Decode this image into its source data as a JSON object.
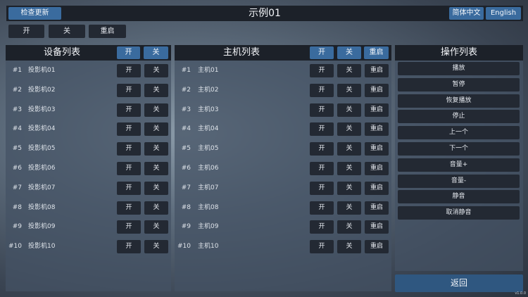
{
  "header": {
    "title": "示例01",
    "check_update_label": "检查更新",
    "lang_zh_label": "简体中文",
    "lang_en_label": "English"
  },
  "quick_actions": {
    "on_label": "开",
    "off_label": "关",
    "restart_label": "重启"
  },
  "device_panel": {
    "title": "设备列表",
    "on_label": "开",
    "off_label": "关",
    "items": [
      {
        "num": "#1",
        "name": "投影机01",
        "on": "开",
        "off": "关"
      },
      {
        "num": "#2",
        "name": "投影机02",
        "on": "开",
        "off": "关"
      },
      {
        "num": "#3",
        "name": "投影机03",
        "on": "开",
        "off": "关"
      },
      {
        "num": "#4",
        "name": "投影机04",
        "on": "开",
        "off": "关"
      },
      {
        "num": "#5",
        "name": "投影机05",
        "on": "开",
        "off": "关"
      },
      {
        "num": "#6",
        "name": "投影机06",
        "on": "开",
        "off": "关"
      },
      {
        "num": "#7",
        "name": "投影机07",
        "on": "开",
        "off": "关"
      },
      {
        "num": "#8",
        "name": "投影机08",
        "on": "开",
        "off": "关"
      },
      {
        "num": "#9",
        "name": "投影机09",
        "on": "开",
        "off": "关"
      },
      {
        "num": "#10",
        "name": "投影机10",
        "on": "开",
        "off": "关"
      }
    ]
  },
  "host_panel": {
    "title": "主机列表",
    "on_label": "开",
    "off_label": "关",
    "restart_label": "重启",
    "items": [
      {
        "num": "#1",
        "name": "主机01",
        "on": "开",
        "off": "关",
        "restart": "重启"
      },
      {
        "num": "#2",
        "name": "主机02",
        "on": "开",
        "off": "关",
        "restart": "重启"
      },
      {
        "num": "#3",
        "name": "主机03",
        "on": "开",
        "off": "关",
        "restart": "重启"
      },
      {
        "num": "#4",
        "name": "主机04",
        "on": "开",
        "off": "关",
        "restart": "重启"
      },
      {
        "num": "#5",
        "name": "主机05",
        "on": "开",
        "off": "关",
        "restart": "重启"
      },
      {
        "num": "#6",
        "name": "主机06",
        "on": "开",
        "off": "关",
        "restart": "重启"
      },
      {
        "num": "#7",
        "name": "主机07",
        "on": "开",
        "off": "关",
        "restart": "重启"
      },
      {
        "num": "#8",
        "name": "主机08",
        "on": "开",
        "off": "关",
        "restart": "重启"
      },
      {
        "num": "#9",
        "name": "主机09",
        "on": "开",
        "off": "关",
        "restart": "重启"
      },
      {
        "num": "#10",
        "name": "主机10",
        "on": "开",
        "off": "关",
        "restart": "重启"
      }
    ]
  },
  "action_panel": {
    "title": "操作列表",
    "items": [
      "播放",
      "暂停",
      "恢复播放",
      "停止",
      "上一个",
      "下一个",
      "音量+",
      "音量-",
      "静音",
      "取消静音"
    ]
  },
  "back_label": "返回",
  "version": "v1.0.0",
  "colors": {
    "accent": "#3a6b9e",
    "button_dark": "#232933",
    "header_bar": "#1c2129"
  }
}
